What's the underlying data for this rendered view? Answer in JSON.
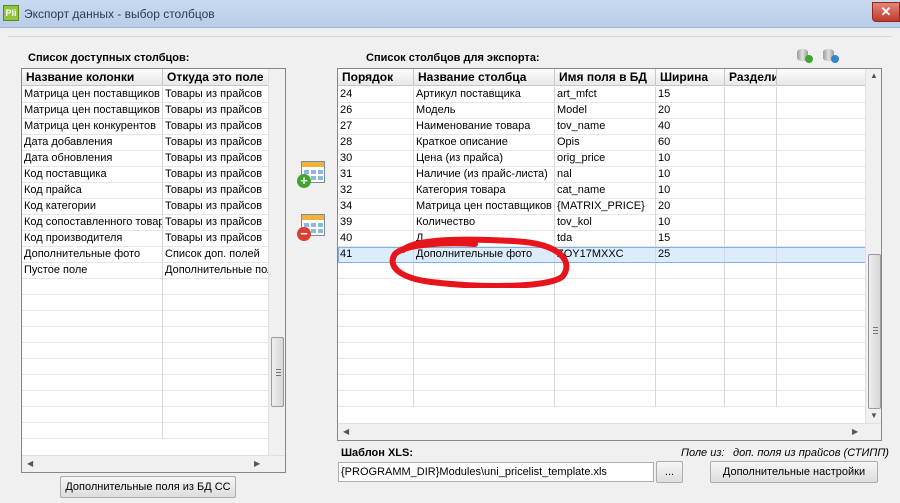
{
  "window": {
    "title": "Экспорт данных - выбор столбцов",
    "app_icon_text": "Pli",
    "close_glyph": "✕"
  },
  "left_panel": {
    "label": "Список доступных столбцов:",
    "headers": [
      "Название колонки",
      "Откуда это поле"
    ],
    "rows": [
      [
        "Матрица цен поставщиков",
        "Товары из прайсов"
      ],
      [
        "Матрица цен поставщиков",
        "Товары из прайсов"
      ],
      [
        "Матрица цен конкурентов",
        "Товары из прайсов"
      ],
      [
        "Дата добавления",
        "Товары из прайсов"
      ],
      [
        "Дата обновления",
        "Товары из прайсов"
      ],
      [
        "Код поставщика",
        "Товары из прайсов"
      ],
      [
        "Код прайса",
        "Товары из прайсов"
      ],
      [
        "Код категории",
        "Товары из прайсов"
      ],
      [
        "Код сопоставленного товара",
        "Товары из прайсов"
      ],
      [
        "Код производителя",
        "Товары из прайсов"
      ],
      [
        "Дополнительные фото",
        "Список доп. полей"
      ],
      [
        "Пустое поле",
        "Дополнительные поля"
      ]
    ]
  },
  "right_panel": {
    "label": "Список столбцов для экспорта:",
    "headers": [
      "Порядок",
      "Название столбца",
      "Имя поля в БД",
      "Ширина",
      "Раздели"
    ],
    "rows": [
      [
        "24",
        "Артикул поставщика",
        "art_mfct",
        "15",
        ""
      ],
      [
        "26",
        "Модель",
        "Model",
        "20",
        ""
      ],
      [
        "27",
        "Наименование товара",
        "tov_name",
        "40",
        ""
      ],
      [
        "28",
        "Краткое описание",
        "Opis",
        "60",
        ""
      ],
      [
        "30",
        "Цена (из прайса)",
        "orig_price",
        "10",
        ""
      ],
      [
        "31",
        "Наличие (из прайс-листа)",
        "nal",
        "10",
        ""
      ],
      [
        "32",
        "Категория товара",
        "cat_name",
        "10",
        ""
      ],
      [
        "34",
        "Матрица цен поставщиков",
        "{MATRIX_PRICE}",
        "20",
        ""
      ],
      [
        "39",
        "Количество",
        "tov_kol",
        "10",
        ""
      ],
      [
        "40",
        "Д",
        "tda",
        "15",
        ""
      ],
      [
        "41",
        "Дополнительные фото",
        "ZOY17MXXC",
        "25",
        ""
      ]
    ],
    "selected_row": 10
  },
  "template": {
    "label": "Шаблон XLS:",
    "path": "{PROGRAMM_DIR}Modules\\uni_pricelist_template.xls",
    "browse_label": "...",
    "fields_from_label": "Поле из:",
    "fields_from_value": "доп. поля из прайсов (СТИПП)"
  },
  "buttons": {
    "extra_fields_db": "Дополнительные поля из БД СС",
    "extra_settings": "Дополнительные настройки"
  },
  "icons": {
    "add_column": "calendar-add-icon",
    "remove_column": "calendar-remove-icon",
    "db_add": "database-add-icon",
    "db_export": "database-export-icon"
  },
  "colors": {
    "annotation": "#e8141c",
    "selection": "#dcecfc",
    "add": "#3ea52e",
    "remove": "#d9402f"
  }
}
